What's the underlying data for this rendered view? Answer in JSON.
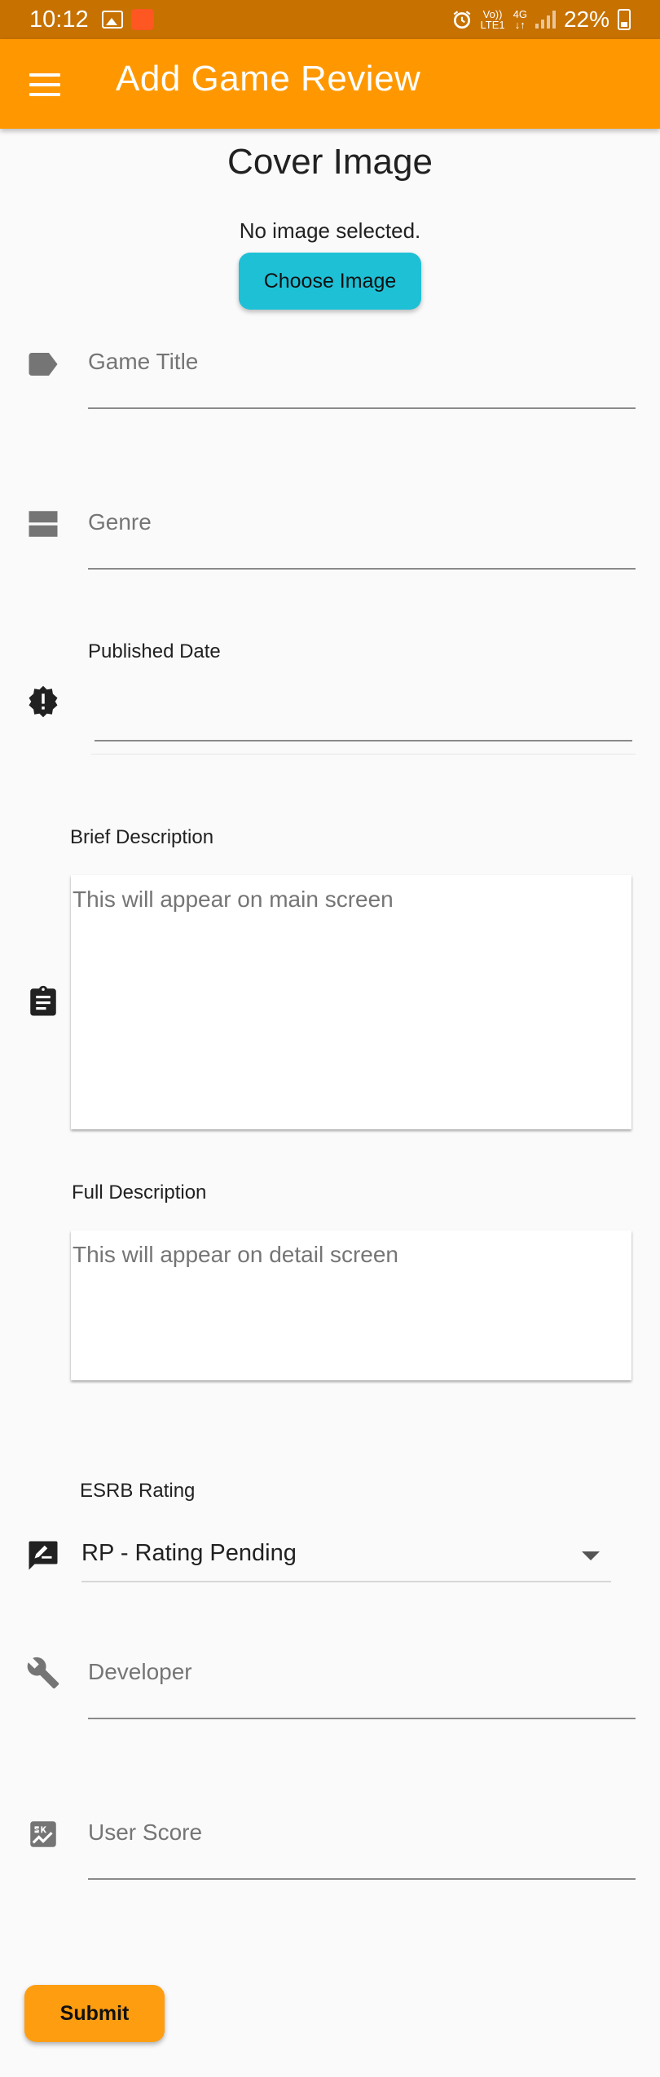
{
  "status_bar": {
    "time": "10:12",
    "volte_top": "Vo))",
    "volte_bottom": "LTE1",
    "network": "4G",
    "battery": "22%"
  },
  "app_bar": {
    "title": "Add Game Review",
    "menu_icon": "menu-icon",
    "color": "#ff9800"
  },
  "cover": {
    "title": "Cover Image",
    "status": "No image selected.",
    "button_label": "Choose Image",
    "button_color": "#1ec0d6"
  },
  "fields": {
    "game_title": {
      "placeholder": "Game Title",
      "icon": "label-icon"
    },
    "genre": {
      "placeholder": "Genre",
      "icon": "view-agenda-icon"
    },
    "published_date": {
      "label": "Published Date",
      "value": "",
      "icon": "alert-badge-icon"
    },
    "brief_description": {
      "label": "Brief Description",
      "placeholder": "This will appear on main screen",
      "icon": "assignment-icon"
    },
    "full_description": {
      "label": "Full Description",
      "placeholder": "This will appear on detail screen"
    },
    "esrb_rating": {
      "label": "ESRB Rating",
      "value": "RP - Rating Pending",
      "icon": "rate-review-icon"
    },
    "developer": {
      "placeholder": "Developer",
      "icon": "wrench-icon"
    },
    "user_score": {
      "placeholder": "User Score",
      "icon": "score-icon"
    }
  },
  "submit": {
    "label": "Submit",
    "color": "#ff9d10"
  }
}
